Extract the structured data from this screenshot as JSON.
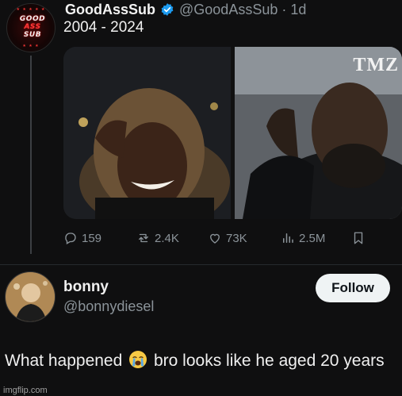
{
  "tweet": {
    "author_name": "GoodAssSub",
    "author_handle": "@GoodAssSub",
    "separator": "·",
    "age": "1d",
    "text": "2004 - 2024",
    "avatar_text": [
      "GOOD",
      "ASS",
      "SUB"
    ],
    "media": {
      "overlay_text": "TMZ"
    }
  },
  "actions": {
    "replies": "159",
    "reposts": "2.4K",
    "likes": "73K",
    "views": "2.5M"
  },
  "reply": {
    "name": "bonny",
    "handle": "@bonnydiesel",
    "follow_label": "Follow",
    "text_before_emoji": "What happened",
    "emoji": "loudly-crying-face",
    "text_after_emoji": "bro looks like he aged 20 years"
  },
  "watermark": "imgflip.com",
  "colors": {
    "background": "#0f0f10",
    "verified_blue": "#1d9bf0",
    "muted_text": "#8b9399",
    "follow_button_bg": "#eff3f4"
  }
}
